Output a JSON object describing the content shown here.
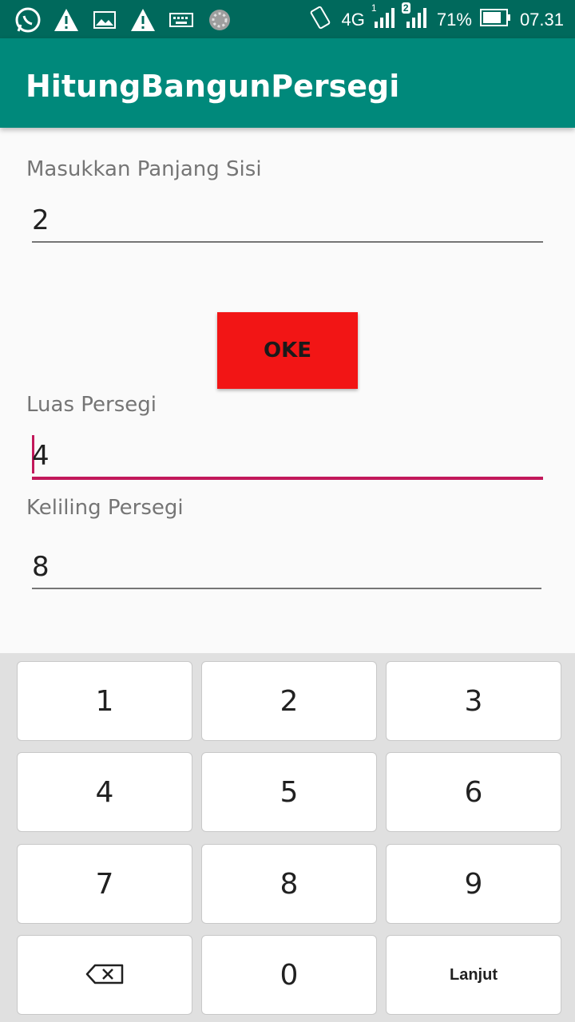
{
  "status_bar": {
    "icons": [
      "whatsapp-icon",
      "warning-icon",
      "image-icon",
      "warning-icon",
      "keyboard-icon",
      "loading-icon"
    ],
    "network": "4G",
    "sim1": "1",
    "sim2": "2",
    "battery": "71%",
    "time": "07.31"
  },
  "app": {
    "title": "HitungBangunPersegi"
  },
  "form": {
    "side_label": "Masukkan Panjang Sisi",
    "side_value": "2",
    "button_label": "OKE",
    "area_label": "Luas Persegi",
    "area_value": "4",
    "perimeter_label": "Keliling Persegi",
    "perimeter_value": "8"
  },
  "keyboard": {
    "keys": [
      "1",
      "2",
      "3",
      "4",
      "5",
      "6",
      "7",
      "8",
      "9",
      "",
      "0",
      "Lanjut"
    ]
  },
  "colors": {
    "status_bar": "#00695c",
    "app_bar": "#00897b",
    "button": "#f21515",
    "accent": "#c2185b"
  }
}
